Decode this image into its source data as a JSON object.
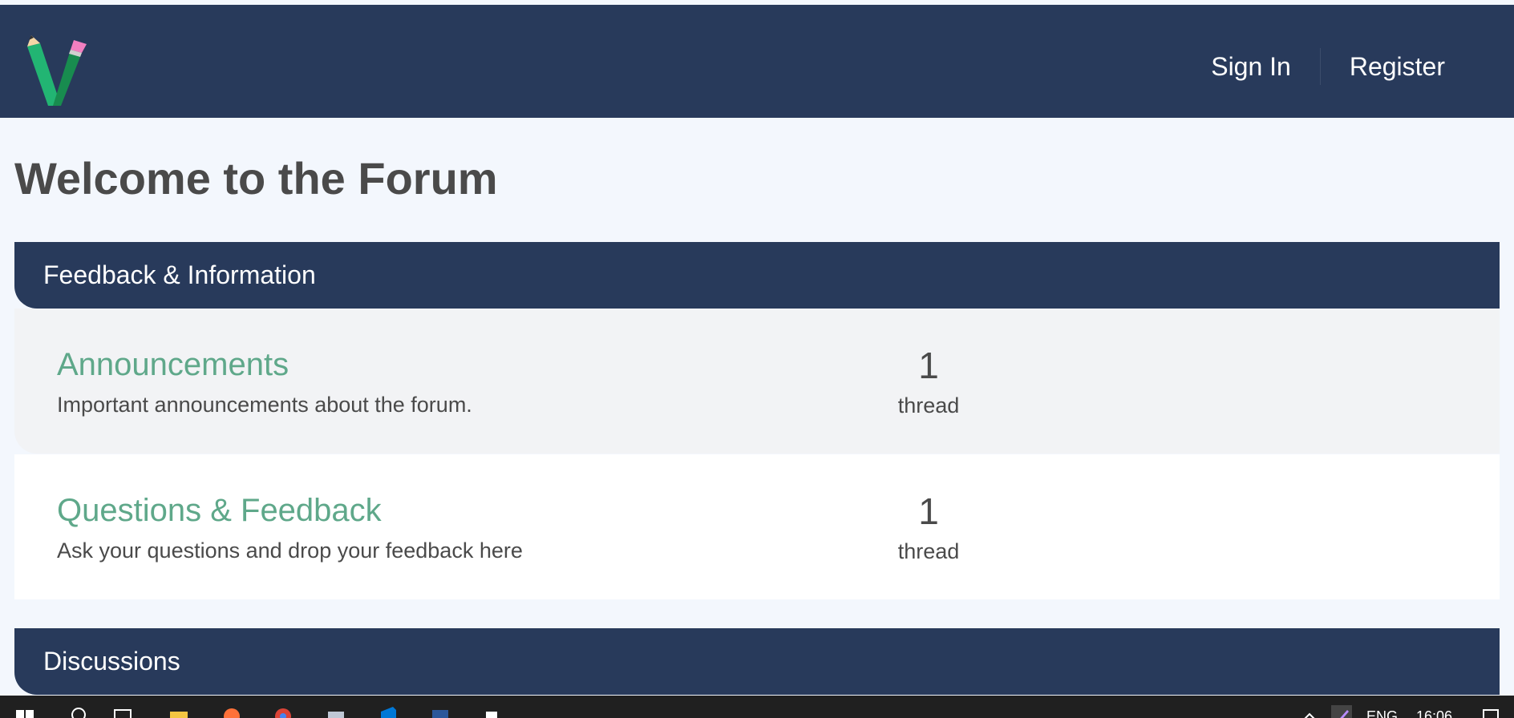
{
  "header": {
    "nav": {
      "sign_in": "Sign In",
      "register": "Register"
    }
  },
  "page": {
    "title": "Welcome to the Forum"
  },
  "sections": [
    {
      "title": "Feedback & Information",
      "forums": [
        {
          "name": "Announcements",
          "description": "Important announcements about the forum.",
          "count": "1",
          "count_label": "thread"
        },
        {
          "name": "Questions & Feedback",
          "description": "Ask your questions and drop your feedback here",
          "count": "1",
          "count_label": "thread"
        }
      ]
    },
    {
      "title": "Discussions"
    }
  ],
  "taskbar": {
    "language": "ENG",
    "clock": "16:06"
  },
  "colors": {
    "header_bg": "#283a5b",
    "page_bg": "#f3f7fd",
    "forum_link": "#5fa88a",
    "text": "#4a4a4a"
  }
}
